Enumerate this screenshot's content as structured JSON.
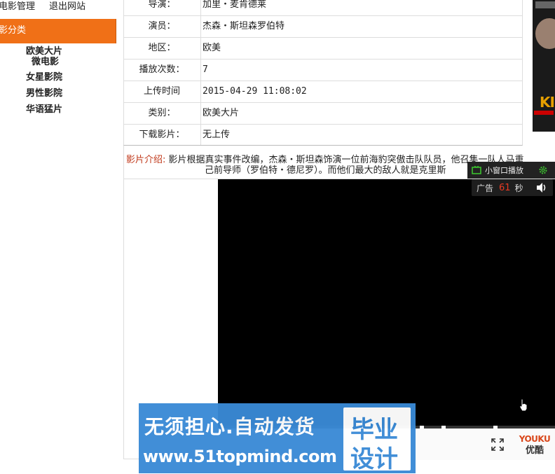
{
  "nav": {
    "manage_label": "电影管理",
    "logout_label": "退出网站"
  },
  "sidebar": {
    "header": "影分类",
    "items": [
      "欧美大片",
      "微电影",
      "女星影院",
      "男性影院",
      "华语猛片"
    ]
  },
  "movie": {
    "rows": [
      {
        "label": "导演：",
        "value": "加里・麦肯德莱"
      },
      {
        "label": "演员：",
        "value": "杰森・斯坦森罗伯特"
      },
      {
        "label": "地区：",
        "value": "欧美"
      },
      {
        "label": "播放次数：",
        "value": "7"
      },
      {
        "label": "上传时间",
        "value": "2015-04-29 11:08:02"
      },
      {
        "label": "类别：",
        "value": "欧美大片"
      },
      {
        "label": "下载影片：",
        "value": "无上传"
      }
    ],
    "intro_label": "影片介绍:",
    "intro_line1": " 影片根据真实事件改编，杰森・斯坦森饰演一位前海豹突傲击队队员，他召集一队人马重",
    "intro_line2": "己前导师（罗伯特・德尼罗）。而他们最大的敌人就是克里斯"
  },
  "player": {
    "mini_window_label": "小窗口播放",
    "ad_label": "广告",
    "ad_seconds": "61",
    "ad_unit": "秒",
    "brand_top": "YOUKU",
    "brand_bottom": "优酷",
    "accent_color": "#e83a22"
  },
  "watermark": {
    "line1": "无须担心.自动发货",
    "line2": "www.51topmind.com",
    "box_line1": "毕业",
    "box_line2": "设计"
  }
}
